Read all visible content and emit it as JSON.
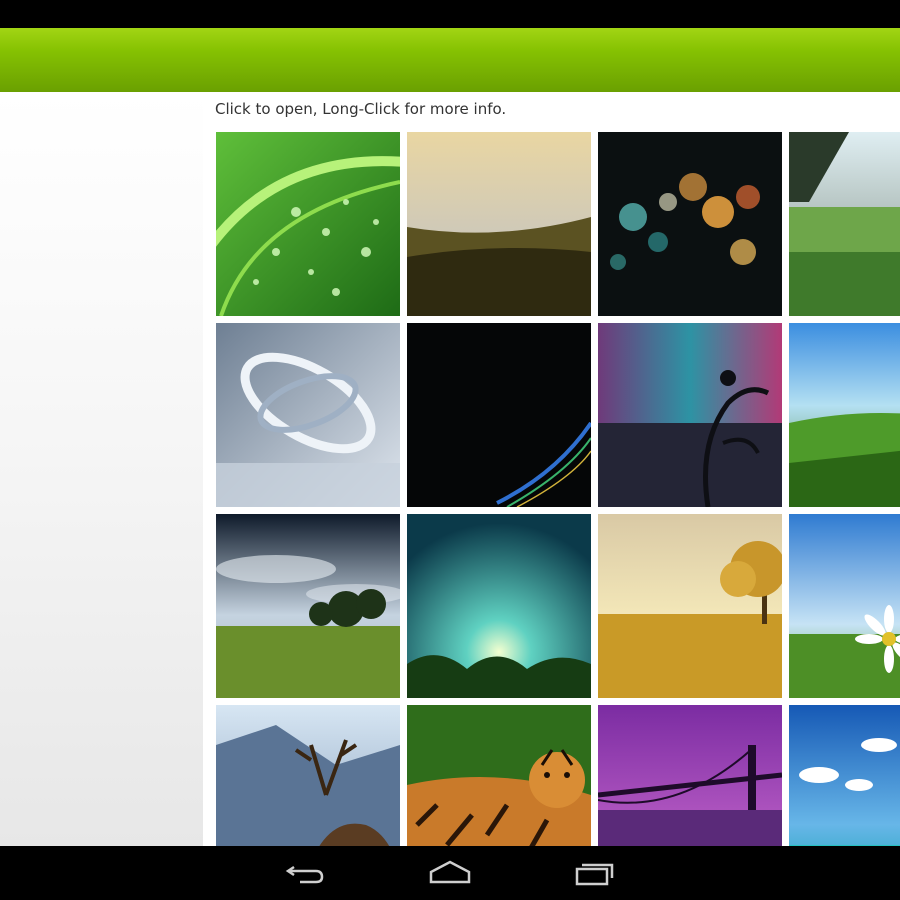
{
  "screen": {
    "hint": "Click to open, Long-Click for more info."
  },
  "wallpapers": [
    {
      "name": "green-leaf-drops"
    },
    {
      "name": "sunset-grass-hill"
    },
    {
      "name": "bokeh-lights"
    },
    {
      "name": "sunlit-meadow"
    },
    {
      "name": "abstract-silver-rings"
    },
    {
      "name": "dark-color-streak"
    },
    {
      "name": "floral-swirl-art"
    },
    {
      "name": "green-grass-blur"
    },
    {
      "name": "trees-under-cloudy-sky"
    },
    {
      "name": "teal-light-rays"
    },
    {
      "name": "golden-field-tree"
    },
    {
      "name": "daisy-blue-sky"
    },
    {
      "name": "deer-mountains"
    },
    {
      "name": "tiger-resting"
    },
    {
      "name": "purple-bridge-night"
    },
    {
      "name": "tropical-beach"
    }
  ],
  "navigation": {
    "back": "back-icon",
    "home": "home-icon",
    "recents": "recent-apps-icon"
  },
  "colors": {
    "action_bar": "#86c202",
    "background": "#ffffff"
  }
}
